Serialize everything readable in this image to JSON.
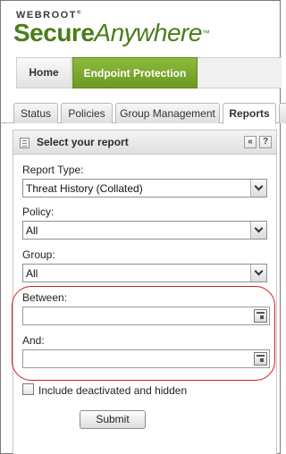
{
  "brand": {
    "company": "WEBROOT",
    "company_mark": "®",
    "product_bold": "Secure",
    "product_light": "Anywhere",
    "product_mark": "™"
  },
  "main_nav": {
    "items": [
      {
        "label": "Home",
        "active": false
      },
      {
        "label": "Endpoint Protection",
        "active": true
      }
    ]
  },
  "tabs": [
    {
      "label": "Status",
      "active": false
    },
    {
      "label": "Policies",
      "active": false
    },
    {
      "label": "Group Management",
      "active": false
    },
    {
      "label": "Reports",
      "active": true
    }
  ],
  "panel": {
    "title": "Select your report",
    "collapse_icon": "double-chevron-left-icon",
    "help_label": "?"
  },
  "form": {
    "report_type": {
      "label": "Report Type:",
      "value": "Threat History (Collated)"
    },
    "policy": {
      "label": "Policy:",
      "value": "All"
    },
    "group": {
      "label": "Group:",
      "value": "All"
    },
    "between": {
      "label": "Between:",
      "value": ""
    },
    "and": {
      "label": "And:",
      "value": ""
    },
    "include_deactivated": {
      "label": "Include deactivated and hidden",
      "checked": false
    },
    "submit_label": "Submit"
  },
  "colors": {
    "brand_green": "#4a7d18",
    "nav_active": "#7aa72e",
    "highlight_red": "#d21e1e"
  }
}
